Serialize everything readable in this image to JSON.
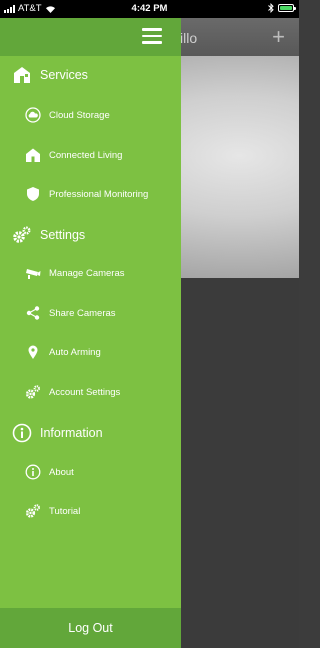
{
  "status_bar": {
    "carrier": "AT&T",
    "time": "4:42 PM"
  },
  "background_app": {
    "logo_text": "illo",
    "add_symbol": "+"
  },
  "drawer": {
    "sections": [
      {
        "label": "Services",
        "icon": "house-icon",
        "items": [
          {
            "label": "Cloud Storage",
            "icon": "cloud-storage-icon"
          },
          {
            "label": "Connected Living",
            "icon": "connected-living-icon"
          },
          {
            "label": "Professional Monitoring",
            "icon": "shield-icon"
          }
        ]
      },
      {
        "label": "Settings",
        "icon": "gears-icon",
        "items": [
          {
            "label": "Manage Cameras",
            "icon": "camera-icon"
          },
          {
            "label": "Share Cameras",
            "icon": "share-icon"
          },
          {
            "label": "Auto Arming",
            "icon": "location-pin-icon"
          },
          {
            "label": "Account Settings",
            "icon": "gears-icon"
          }
        ]
      },
      {
        "label": "Information",
        "icon": "info-icon",
        "items": [
          {
            "label": "About",
            "icon": "info-icon"
          },
          {
            "label": "Tutorial",
            "icon": "gears-icon"
          }
        ]
      }
    ],
    "logout_label": "Log Out"
  },
  "colors": {
    "drawer_bg": "#7dc142",
    "drawer_header": "#62a73a"
  }
}
